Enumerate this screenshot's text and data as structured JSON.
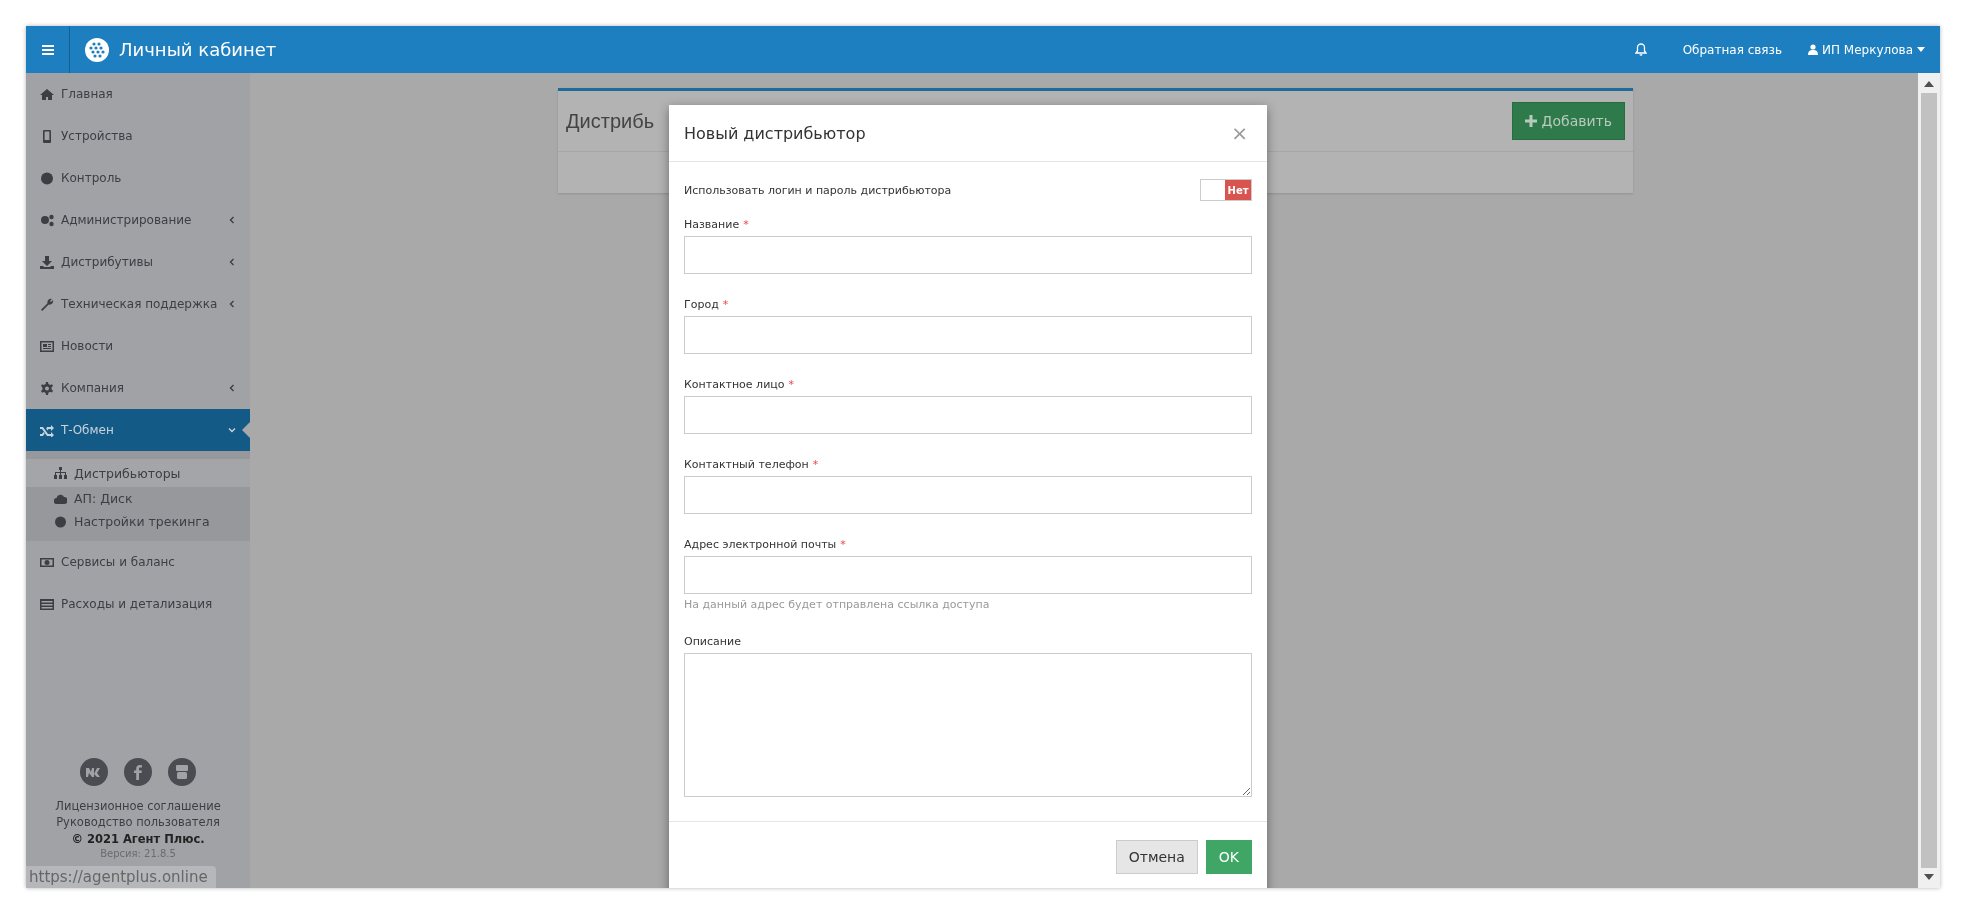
{
  "header": {
    "title": "Личный кабинет",
    "feedback": "Обратная связь",
    "user": "ИП Меркулова"
  },
  "sidebar": {
    "items": [
      {
        "label": "Главная",
        "selected": false
      },
      {
        "label": "Устройства",
        "selected": false
      },
      {
        "label": "Контроль",
        "selected": false
      },
      {
        "label": "Администрирование",
        "selected": false,
        "expanded": false
      },
      {
        "label": "Дистрибутивы",
        "selected": false,
        "expanded": false
      },
      {
        "label": "Техническая поддержка",
        "selected": false,
        "expanded": false
      },
      {
        "label": "Новости",
        "selected": false
      },
      {
        "label": "Компания",
        "selected": false,
        "expanded": false
      },
      {
        "label": "Т-Обмен",
        "selected": true,
        "expanded": true,
        "children": [
          {
            "label": "Дистрибьюторы",
            "selected": true
          },
          {
            "label": "АП: Диск",
            "selected": false
          },
          {
            "label": "Настройки трекинга",
            "selected": false
          }
        ]
      },
      {
        "label": "Сервисы и баланс",
        "selected": false
      },
      {
        "label": "Расходы и детализация",
        "selected": false
      }
    ],
    "footer": {
      "links": [
        "Лицензионное соглашение",
        "Руководство пользователя"
      ],
      "copyright": "© 2021 Агент Плюс.",
      "version": "Версия: 21.8.5"
    }
  },
  "status_url": "https://agentplus.online",
  "page": {
    "title": "Дистрибь",
    "add_button": "Добавить"
  },
  "modal": {
    "title": "Новый дистрибьютор",
    "close": "×",
    "required_mark": "*",
    "toggle": {
      "label": "Использовать логин и пароль дистрибьютора",
      "on": false,
      "off_text": "Нет"
    },
    "fields": [
      {
        "kind": "input",
        "label": "Название",
        "required": true
      },
      {
        "kind": "input",
        "label": "Город",
        "required": true
      },
      {
        "kind": "input",
        "label": "Контактное лицо",
        "required": true
      },
      {
        "kind": "input",
        "label": "Контактный телефон",
        "required": true
      },
      {
        "kind": "input",
        "label": "Адрес электронной почты",
        "required": true,
        "help": "На данный адрес будет отправлена ссылка доступа"
      },
      {
        "kind": "textarea",
        "label": "Описание",
        "required": false
      }
    ],
    "buttons": {
      "cancel": "Отмена",
      "ok": "OK"
    }
  }
}
